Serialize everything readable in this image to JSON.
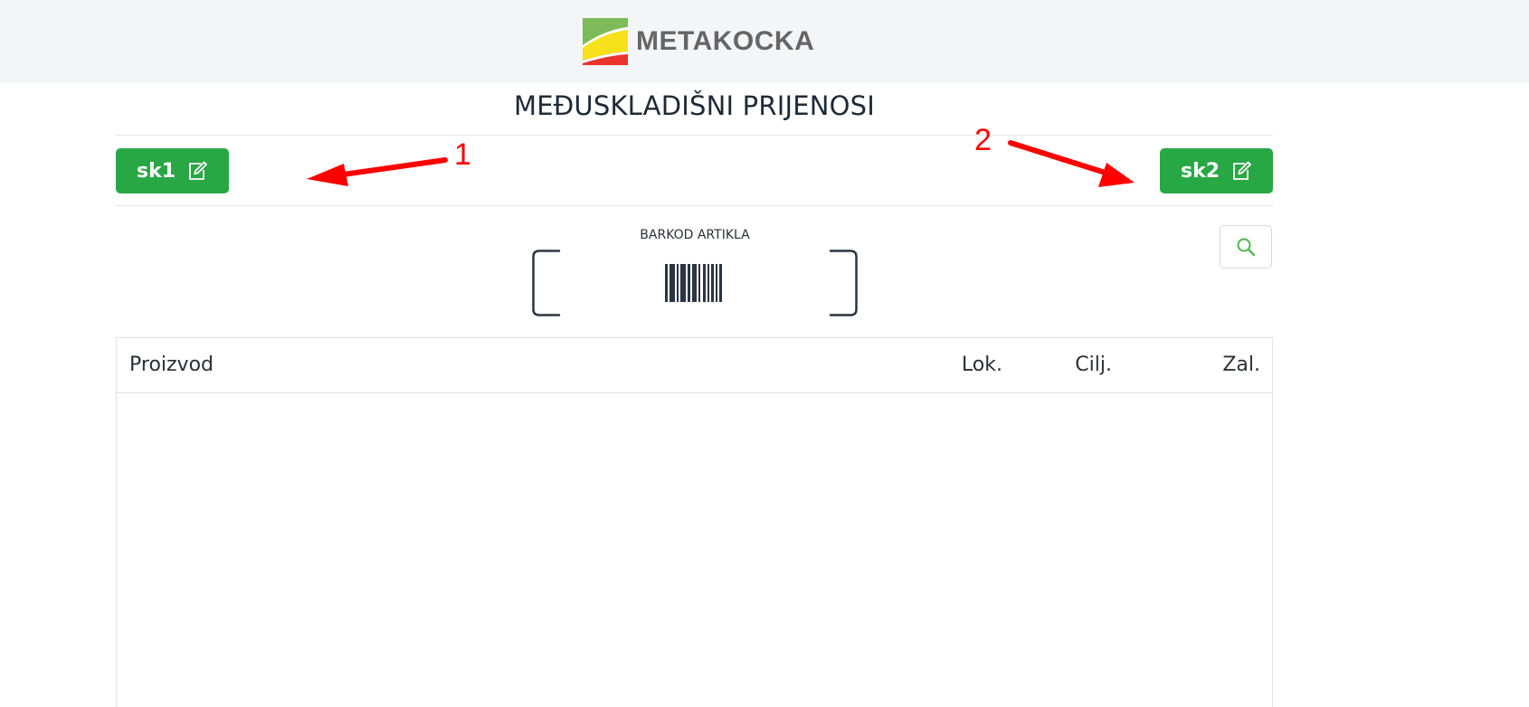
{
  "header": {
    "brand_name": "METAKOCKA",
    "brand_colors": {
      "green": "#7dbb5a",
      "yellow": "#f6e11a",
      "red": "#e8342a"
    }
  },
  "page": {
    "title": "MEĐUSKLADIŠNI PRIJENOSI"
  },
  "warehouses": {
    "source": {
      "label": "sk1",
      "icon": "edit-icon"
    },
    "target": {
      "label": "sk2",
      "icon": "edit-icon"
    }
  },
  "annotations": {
    "marker_1": "1",
    "marker_2": "2",
    "color": "#ff0000"
  },
  "scanner": {
    "label": "BARKOD ARTIKLA",
    "icon": "barcode-icon"
  },
  "search": {
    "icon": "search-icon",
    "color": "#5cb85c"
  },
  "table": {
    "columns": [
      "Proizvod",
      "Lok.",
      "Cilj.",
      "Zal."
    ],
    "rows": []
  },
  "theme": {
    "accent": "#28a745",
    "text_dark": "#1f2a37"
  }
}
